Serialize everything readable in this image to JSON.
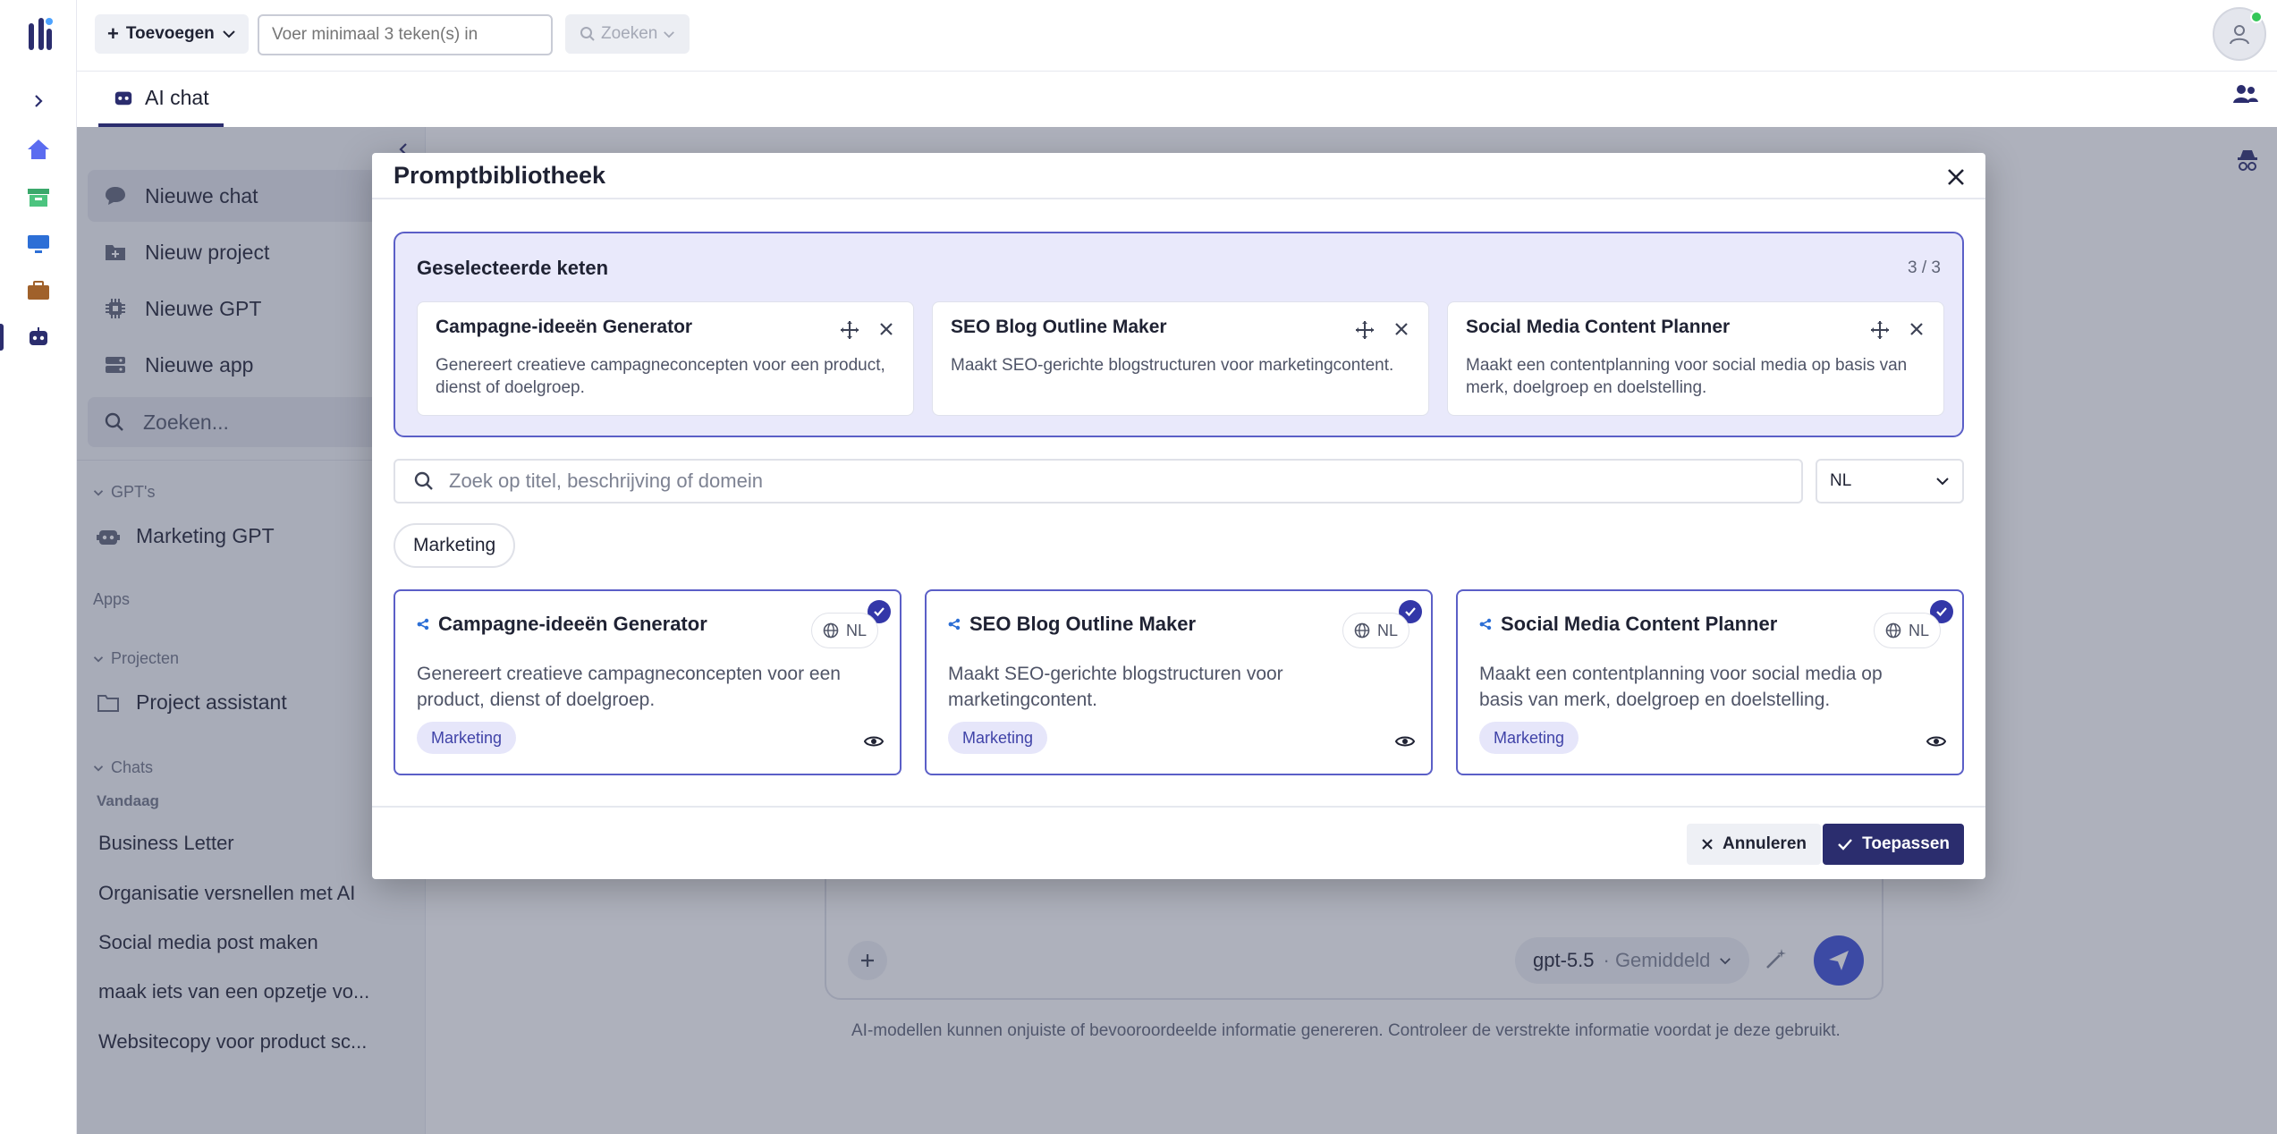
{
  "topbar": {
    "add_label": "Toevoegen",
    "search_placeholder": "Voer minimaal 3 teken(s) in",
    "search_button": "Zoeken"
  },
  "tabs": [
    {
      "label": "AI chat",
      "icon": "robot-icon"
    }
  ],
  "sidebar": {
    "actions": [
      {
        "label": "Nieuwe chat",
        "icon": "chat-bubble-icon"
      },
      {
        "label": "Nieuw project",
        "icon": "folder-plus-icon"
      },
      {
        "label": "Nieuwe GPT",
        "icon": "chip-icon"
      },
      {
        "label": "Nieuwe app",
        "icon": "server-icon"
      }
    ],
    "search_placeholder": "Zoeken...",
    "sections": {
      "gpts": "GPT's",
      "apps": "Apps",
      "projects": "Projecten",
      "chats": "Chats",
      "today": "Vandaag"
    },
    "gpt_items": [
      {
        "label": "Marketing GPT"
      }
    ],
    "project_items": [
      {
        "label": "Project assistant"
      }
    ],
    "chat_items": [
      "Business Letter",
      "Organisatie versnellen met AI",
      "Social media post maken",
      "maak iets van een opzetje vo...",
      "Websitecopy voor product sc..."
    ]
  },
  "composer": {
    "model": "gpt-5.5",
    "model_effort": "· Gemiddeld",
    "disclaimer": "AI-modellen kunnen onjuiste of bevooroordeelde informatie genereren. Controleer de verstrekte informatie voordat je deze gebruikt."
  },
  "modal": {
    "title": "Promptbibliotheek",
    "chain": {
      "title": "Geselecteerde keten",
      "count": "3 / 3",
      "items": [
        {
          "title": "Campagne-ideeën Generator",
          "desc": "Genereert creatieve campagneconcepten voor een product, dienst of doelgroep."
        },
        {
          "title": "SEO Blog Outline Maker",
          "desc": "Maakt SEO-gerichte blogstructuren voor marketingcontent."
        },
        {
          "title": "Social Media Content Planner",
          "desc": "Maakt een contentplanning voor social media op basis van merk, doelgroep en doelstelling."
        }
      ]
    },
    "search_placeholder": "Zoek op titel, beschrijving of domein",
    "language": "NL",
    "filter_chip": "Marketing",
    "cards": [
      {
        "title": "Campagne-ideeën Generator",
        "lang": "NL",
        "desc": "Genereert creatieve campagneconcepten voor een product, dienst of doelgroep.",
        "tag": "Marketing",
        "selected": true
      },
      {
        "title": "SEO Blog Outline Maker",
        "lang": "NL",
        "desc": "Maakt SEO-gerichte blogstructuren voor marketingcontent.",
        "tag": "Marketing",
        "selected": true
      },
      {
        "title": "Social Media Content Planner",
        "lang": "NL",
        "desc": "Maakt een contentplanning voor social media op basis van merk, doelgroep en doelstelling.",
        "tag": "Marketing",
        "selected": true
      }
    ],
    "cancel_label": "Annuleren",
    "apply_label": "Toepassen"
  },
  "colors": {
    "brand_dark": "#2b2d6e",
    "accent": "#5b5fc7",
    "chain_bg": "#e9e9fb",
    "send": "#3c4fd6"
  }
}
